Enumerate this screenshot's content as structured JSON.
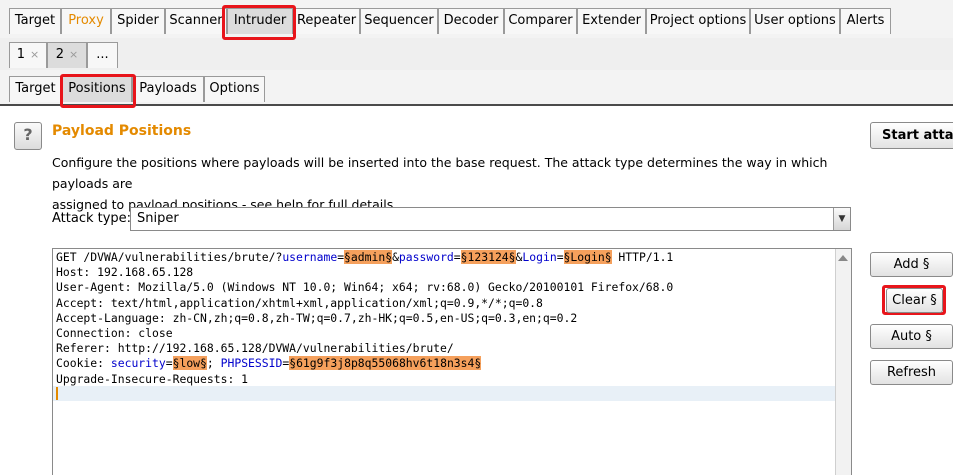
{
  "main_tabs": [
    {
      "label": "Target"
    },
    {
      "label": "Proxy"
    },
    {
      "label": "Spider"
    },
    {
      "label": "Scanner"
    },
    {
      "label": "Intruder"
    },
    {
      "label": "Repeater"
    },
    {
      "label": "Sequencer"
    },
    {
      "label": "Decoder"
    },
    {
      "label": "Comparer"
    },
    {
      "label": "Extender"
    },
    {
      "label": "Project options"
    },
    {
      "label": "User options"
    },
    {
      "label": "Alerts"
    }
  ],
  "request_tabs": [
    {
      "label": "1",
      "close": "×"
    },
    {
      "label": "2",
      "close": "×"
    },
    {
      "label": "..."
    }
  ],
  "intruder_tabs": [
    {
      "label": "Target"
    },
    {
      "label": "Positions"
    },
    {
      "label": "Payloads"
    },
    {
      "label": "Options"
    }
  ],
  "help_icon": "?",
  "positions": {
    "title": "Payload Positions",
    "description_line1": "Configure the positions where payloads will be inserted into the base request. The attack type determines the way in which payloads are",
    "description_line2": "assigned to payload positions - see help for full details.",
    "attack_type_label": "Attack type:",
    "attack_type_value": "Sniper"
  },
  "request": {
    "line1_a": "GET /DVWA/vulnerabilities/brute/?",
    "line1_username": "username",
    "line1_eq1": "=",
    "line1_p1": "§admin§",
    "line1_amp1": "&",
    "line1_password": "password",
    "line1_eq2": "=",
    "line1_p2": "§123124§",
    "line1_amp2": "&",
    "line1_login": "Login",
    "line1_eq3": "=",
    "line1_p3": "§Login§",
    "line1_tail": " HTTP/1.1",
    "host": "Host: 192.168.65.128",
    "user_agent": "User-Agent: Mozilla/5.0 (Windows NT 10.0; Win64; x64; rv:68.0) Gecko/20100101 Firefox/68.0",
    "accept": "Accept: text/html,application/xhtml+xml,application/xml;q=0.9,*/*;q=0.8",
    "accept_language": "Accept-Language: zh-CN,zh;q=0.8,zh-TW;q=0.7,zh-HK;q=0.5,en-US;q=0.3,en;q=0.2",
    "connection": "Connection: close",
    "referer": "Referer: http://192.168.65.128/DVWA/vulnerabilities/brute/",
    "cookie_a": "Cookie: ",
    "cookie_security": "security",
    "cookie_eq1": "=",
    "cookie_p1": "§low§",
    "cookie_sep": "; ",
    "cookie_phpsessid": "PHPSESSID",
    "cookie_eq2": "=",
    "cookie_p2": "§61g9f3j8p8q55068hv6t18n3s4§",
    "upgrade": "Upgrade-Insecure-Requests: 1"
  },
  "buttons": {
    "start_attack": "Start attack",
    "add": "Add §",
    "clear": "Clear §",
    "auto": "Auto §",
    "refresh": "Refresh"
  },
  "colors": {
    "accent_orange": "#e48a00",
    "payload_marker": "#f5a05c",
    "highlight_red": "#e8151b",
    "param_name_blue": "#0000cc"
  }
}
